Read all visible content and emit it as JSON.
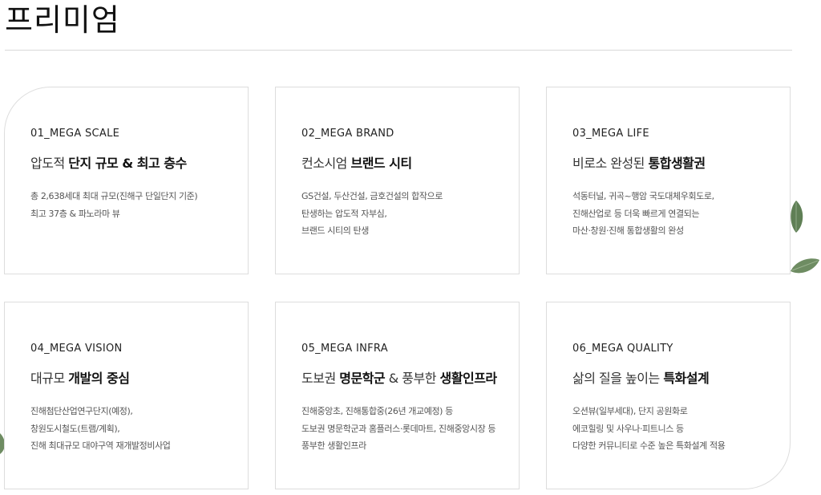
{
  "page": {
    "title": "프리미엄"
  },
  "cards": [
    {
      "num": "01_MEGA SCALE",
      "heading_light": "압도적 ",
      "heading_bold": "단지 규모 & 최고 층수",
      "heading_tail": "",
      "lines": [
        "총 2,638세대 최대 규모(진해구 단일단지 기준)",
        "최고 37층 & 파노라마 뷰"
      ]
    },
    {
      "num": "02_MEGA BRAND",
      "heading_light": "컨소시엄 ",
      "heading_bold": "브랜드 시티",
      "heading_tail": "",
      "lines": [
        "GS건설, 두산건설, 금호건설의 합작으로",
        "탄생하는 압도적 자부심,",
        "브랜드 시티의 탄생"
      ]
    },
    {
      "num": "03_MEGA LIFE",
      "heading_light": "비로소 완성된 ",
      "heading_bold": "통합생활권",
      "heading_tail": "",
      "lines": [
        "석동터널, 귀곡~행암 국도대체우회도로,",
        "진해산업로 등 더욱 빠르게 연결되는",
        "마산·창원·진해 통합생활의 완성"
      ]
    },
    {
      "num": "04_MEGA VISION",
      "heading_light": "대규모 ",
      "heading_bold": "개발의 중심",
      "heading_tail": "",
      "lines": [
        "진해첨단산업연구단지(예정),",
        "창원도시철도(트램/계획),",
        "진해 최대규모 대야구역 재개발정비사업"
      ]
    },
    {
      "num": "05_MEGA INFRA",
      "heading_light": "도보권 ",
      "heading_bold": "명문학군",
      "heading_tail": " & 풍부한 ",
      "heading_bold2": "생활인프라",
      "lines": [
        "진해중앙초, 진해통합중(26년 개교예정) 등",
        "도보권 명문학군과 홈플러스·롯데마트, 진해중앙시장 등",
        "풍부한 생활인프라"
      ]
    },
    {
      "num": "06_MEGA QUALITY",
      "heading_light": "삶의 질을 높이는 ",
      "heading_bold": "특화설계",
      "heading_tail": "",
      "lines": [
        "오션뷰(일부세대), 단지 공원화로",
        "에코힐링 및 사우나·피트니스 등",
        "다양한 커뮤니티로 수준 높은 특화설계 적용"
      ]
    }
  ],
  "colors": {
    "border": "#dddddd",
    "leaf": "#5f7f55",
    "text": "#222222"
  }
}
